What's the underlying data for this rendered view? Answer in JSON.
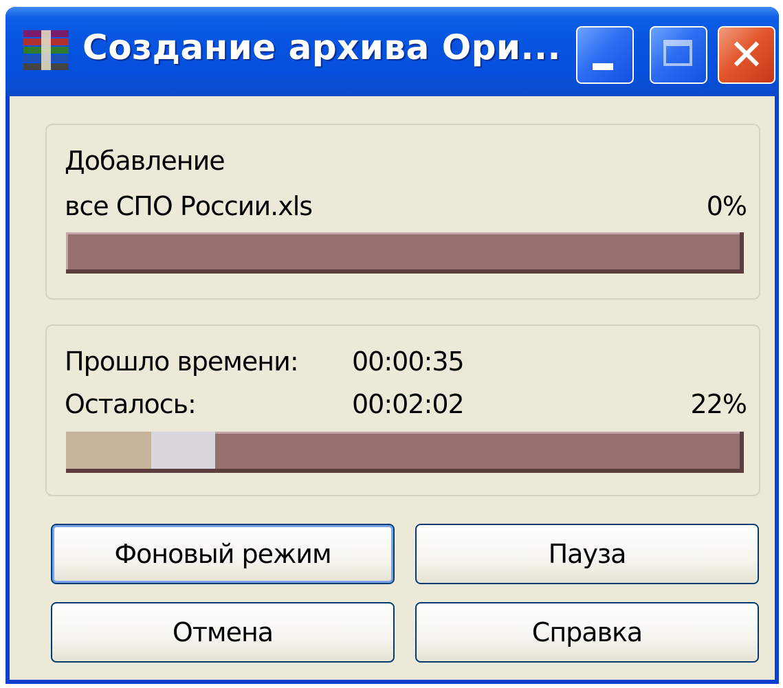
{
  "window": {
    "title": "Создание архива Ори..."
  },
  "titlebar_buttons": [
    "minimize",
    "maximize",
    "close"
  ],
  "current_file": {
    "action_label": "Добавление",
    "file_name": "все СПО России.xls",
    "percent_text": "0%",
    "progress": 0
  },
  "total": {
    "elapsed_label": "Прошло времени:",
    "elapsed_value": "00:00:35",
    "remaining_label": "Осталось:",
    "remaining_value": "00:02:02",
    "percent_text": "22%",
    "progress": 0.22
  },
  "buttons": {
    "background": "Фоновый режим",
    "pause": "Пауза",
    "cancel": "Отмена",
    "help": "Справка"
  },
  "colors": {
    "titlebar": "#0654e0",
    "client": "#ece9d8",
    "progress_track": "#986f6f",
    "progress_fill": "#c9b59c",
    "close_button": "#e2572d"
  },
  "icons": {
    "app": "winrar-books-icon",
    "minimize": "minimize-icon",
    "maximize": "maximize-icon",
    "close": "close-icon"
  }
}
